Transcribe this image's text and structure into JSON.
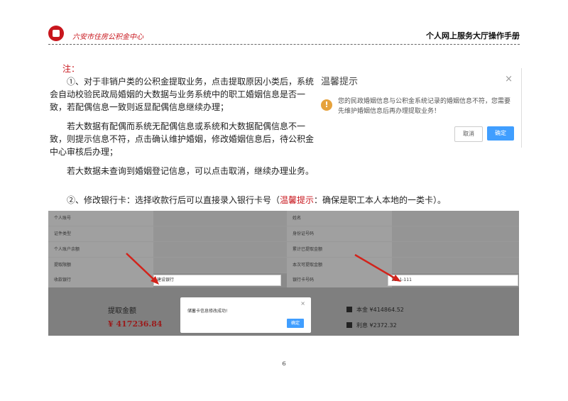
{
  "header": {
    "org": "六安市住房公积金中心",
    "manual": "个人网上服务大厅操作手册"
  },
  "body": {
    "note_label": "注：",
    "p1": "①、对于非销户类的公积金提取业务，点击提取原因小类后，系统会自动校验民政局婚姻的大数据与业务系统中的职工婚姻信息是否一致，若配偶信息一致则返显配偶信息继续办理；",
    "p2": "若大数据有配偶而系统无配偶信息或系统和大数据配偶信息不一致，则提示信息不符，点击确认维护婚姻，修改婚姻信息后，待公积金中心审核后办理；",
    "p3": "若大数据未查询到婚姻登记信息，可以点击取消，继续办理业务。",
    "p4_a": "②、修改银行卡：选择收款行后可以直接录入银行卡号（",
    "p4_red": "温馨提示",
    "p4_b": "：确保是职工本人本地的一类卡）。"
  },
  "dialog": {
    "title": "温馨提示",
    "close": "×",
    "warn_icon": "!",
    "message": "您的民政婚姻信息与公积金系统记录的婚姻信息不符，您需要先维护婚姻信息后再办理提取业务！",
    "cancel": "取消",
    "ok": "确定"
  },
  "form": {
    "rows": [
      {
        "l1": "个人账号",
        "v1": "",
        "l2": "姓名",
        "v2": ""
      },
      {
        "l1": "证件类型",
        "v1": "",
        "l2": "身份证号码",
        "v2": ""
      },
      {
        "l1": "个人账户余额",
        "v1": "",
        "l2": "累计已提取金额",
        "v2": ""
      },
      {
        "l1": "提取限额",
        "v1": "",
        "l2": "本次可提取金额",
        "v2": ""
      },
      {
        "l1": "收款银行",
        "v1": "建设银行",
        "l2": "银行卡号码",
        "v2": "1111-111"
      }
    ],
    "amount_label": "提取金额",
    "amount_value": "¥ 417236.84",
    "principal": "本金 ¥414864.52",
    "interest": "利息 ¥2372.32"
  },
  "modal": {
    "message": "储蓄卡信息修改成功!",
    "close": "×",
    "ok": "确定"
  },
  "page_number": "6"
}
